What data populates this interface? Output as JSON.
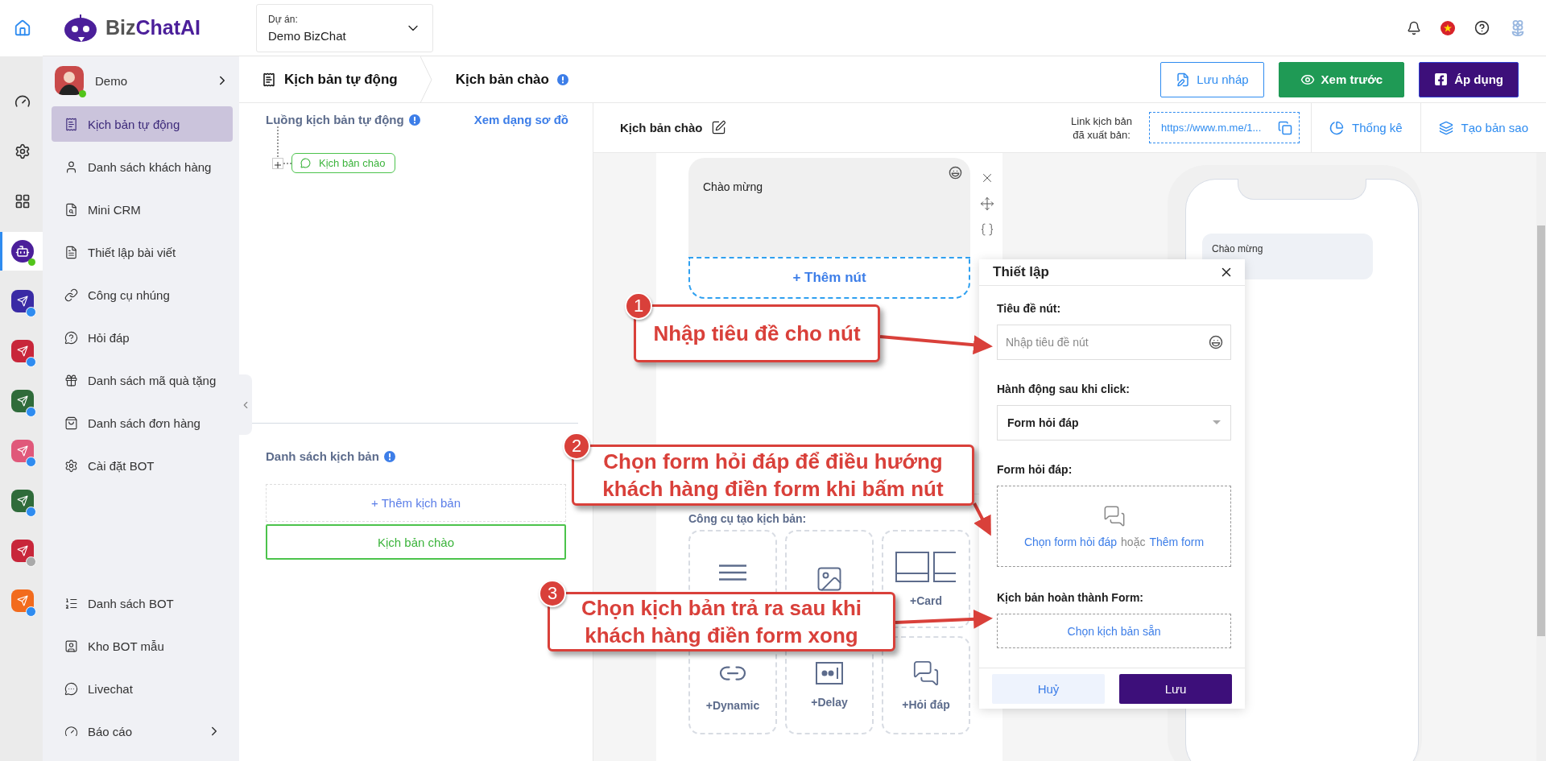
{
  "rail": {
    "items": [
      {
        "kind": "home",
        "selected": false
      },
      {
        "kind": "dashboard",
        "selected": false
      },
      {
        "kind": "settings",
        "selected": false
      },
      {
        "kind": "apps",
        "selected": false
      },
      {
        "kind": "bot",
        "selected": true
      },
      {
        "kind": "app",
        "color": "#3a2ba5",
        "disabled": false
      },
      {
        "kind": "app",
        "color": "#c8263a",
        "disabled": false
      },
      {
        "kind": "app",
        "color": "#2f6b3a",
        "disabled": false
      },
      {
        "kind": "app",
        "color": "#e0587a",
        "disabled": false
      },
      {
        "kind": "app",
        "color": "#2f6b3a",
        "disabled": false
      },
      {
        "kind": "app",
        "color": "#c8263a",
        "disabled": true
      },
      {
        "kind": "app",
        "color": "#f26b1d",
        "disabled": false
      }
    ]
  },
  "header": {
    "logo": {
      "lead": "Biz",
      "rest": "ChatAI"
    },
    "project": {
      "label": "Dự án:",
      "value": "Demo BizChat"
    }
  },
  "sidebar": {
    "user": {
      "name": "Demo",
      "online": true
    },
    "items": [
      {
        "label": "Kịch bản tự động",
        "selected": true,
        "has_children": false
      },
      {
        "label": "Danh sách khách hàng",
        "selected": false,
        "has_children": false
      },
      {
        "label": "Mini CRM",
        "selected": false,
        "has_children": false
      },
      {
        "label": "Thiết lập bài viết",
        "selected": false,
        "has_children": false
      },
      {
        "label": "Công cụ nhúng",
        "selected": false,
        "has_children": false
      },
      {
        "label": "Hỏi đáp",
        "selected": false,
        "has_children": false
      },
      {
        "label": "Danh sách mã quà tặng",
        "selected": false,
        "has_children": false
      },
      {
        "label": "Danh sách đơn hàng",
        "selected": false,
        "has_children": false
      },
      {
        "label": "Cài đặt BOT",
        "selected": false,
        "has_children": false
      }
    ],
    "bottom_items": [
      {
        "label": "Danh sách BOT",
        "selected": false,
        "has_children": false
      },
      {
        "label": "Kho BOT mẫu",
        "selected": false,
        "has_children": false
      },
      {
        "label": "Livechat",
        "selected": false,
        "has_children": false
      },
      {
        "label": "Báo cáo",
        "selected": false,
        "has_children": true
      }
    ]
  },
  "breadcrumb": [
    "Kịch bản tự động",
    "Kịch bản chào"
  ],
  "actions": [
    {
      "kind": "draft",
      "label": "Lưu nháp"
    },
    {
      "kind": "preview",
      "label": "Xem trước"
    },
    {
      "kind": "apply",
      "label": "Áp dụng"
    }
  ],
  "flow": {
    "title": "Luồng kịch bản tự động",
    "view_link": "Xem dạng sơ đồ",
    "node": "Kịch bản chào"
  },
  "script_list": {
    "title": "Danh sách kịch bản",
    "add": "+ Thêm kịch bản",
    "items": [
      {
        "label": "Kịch bản chào",
        "selected": true
      }
    ]
  },
  "editor": {
    "title": "Kịch bản chào",
    "link_label": "Link kịch bản đã xuất bản:",
    "link": "https://www.m.me/1...",
    "tools": [
      "Thống kê",
      "Tạo bản sao"
    ],
    "message": "Chào mừng",
    "add_button": "+ Thêm nút",
    "toolbox_title": "Công cụ tạo kịch bản:",
    "blocks": [
      {
        "kind": "text"
      },
      {
        "kind": "image"
      },
      {
        "kind": "card",
        "label": "+Card"
      },
      {
        "kind": "dynamic",
        "label": "+Dynamic"
      },
      {
        "kind": "delay",
        "label": "+Delay"
      },
      {
        "kind": "qa",
        "label": "+Hỏi đáp"
      }
    ]
  },
  "preview": {
    "message": "Chào mừng"
  },
  "settings": {
    "title": "Thiết lập",
    "button_title_label": "Tiêu đề nút:",
    "button_title_placeholder": "Nhập tiêu đề nút",
    "action_label": "Hành động sau khi click:",
    "action_value": "Form hỏi đáp",
    "form_label": "Form hỏi đáp:",
    "choose_form": "Chọn form hỏi đáp",
    "or": "hoặc",
    "add_form": "Thêm form",
    "done_label": "Kịch bản hoàn thành Form:",
    "choose_script": "Chọn kịch bản sẵn",
    "cancel": "Huỷ",
    "save": "Lưu"
  },
  "callouts": [
    {
      "number": "1",
      "text": "Nhập tiêu đề cho nút"
    },
    {
      "number": "2",
      "text": "Chọn form hỏi đáp để điều hướng khách hàng điền form khi bấm nút"
    },
    {
      "number": "3",
      "text": "Chọn kịch bản trả ra sau khi khách hàng điền form xong"
    }
  ]
}
